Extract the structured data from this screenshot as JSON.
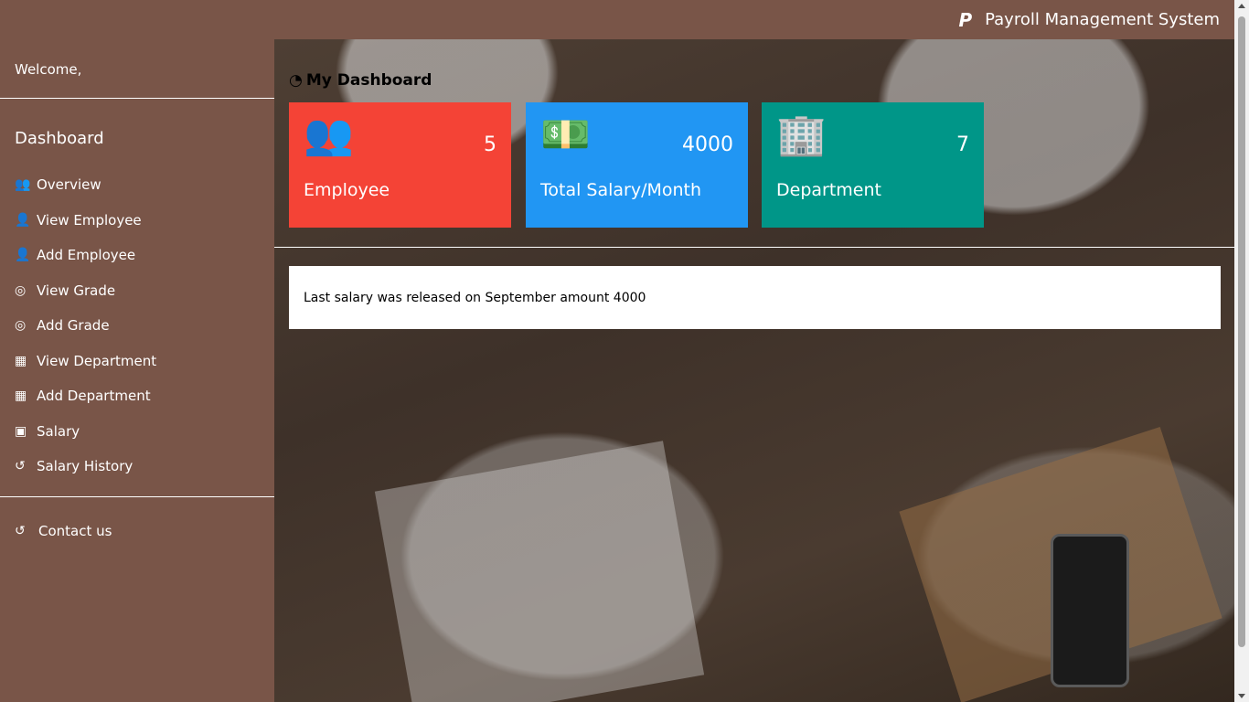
{
  "header": {
    "title": "Payroll Management System",
    "logo_icon": "paypal-icon"
  },
  "sidebar": {
    "welcome": "Welcome,",
    "section_title": "Dashboard",
    "items": [
      {
        "label": "Overview",
        "icon": "users-icon",
        "glyph": "👥"
      },
      {
        "label": "View Employee",
        "icon": "user-icon",
        "glyph": "👤"
      },
      {
        "label": "Add Employee",
        "icon": "user-icon",
        "glyph": "👤"
      },
      {
        "label": "View Grade",
        "icon": "bullseye-icon",
        "glyph": "◎"
      },
      {
        "label": "Add Grade",
        "icon": "bullseye-icon",
        "glyph": "◎"
      },
      {
        "label": "View Department",
        "icon": "building-icon",
        "glyph": "▦"
      },
      {
        "label": "Add Department",
        "icon": "building-icon",
        "glyph": "▦"
      },
      {
        "label": "Salary",
        "icon": "money-icon",
        "glyph": "▣"
      },
      {
        "label": "Salary History",
        "icon": "history-icon",
        "glyph": "↺"
      }
    ],
    "contact": {
      "label": "Contact us",
      "icon": "history-icon",
      "glyph": "↺"
    }
  },
  "main": {
    "heading": "My Dashboard",
    "heading_icon": "dashboard-icon",
    "cards": [
      {
        "label": "Employee",
        "value": "5",
        "icon": "users-icon",
        "color": "#f44336"
      },
      {
        "label": "Total Salary/Month",
        "value": "4000",
        "icon": "money-icon",
        "color": "#2196f3"
      },
      {
        "label": "Department",
        "value": "7",
        "icon": "building-icon",
        "color": "#009688"
      }
    ],
    "notice": "Last salary was released on September amount 4000"
  },
  "colors": {
    "sidebar": "#795548",
    "topbar": "#795548"
  }
}
